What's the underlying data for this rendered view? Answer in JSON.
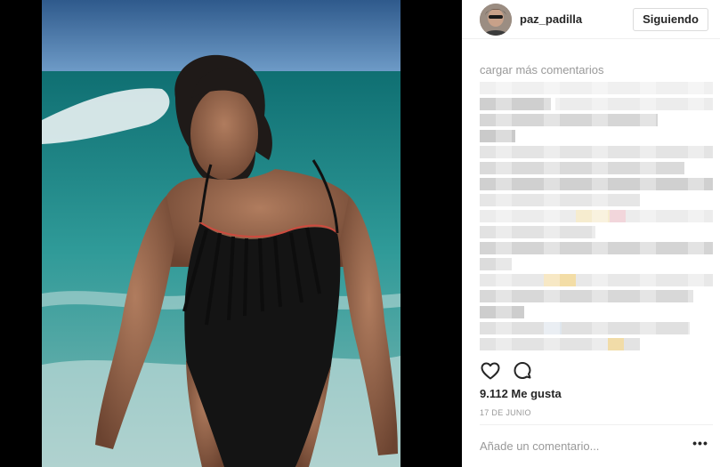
{
  "post": {
    "username": "paz_padilla",
    "follow_label": "Siguiendo",
    "photo_alt": "Mujer con bañador negro en la playa"
  },
  "comments": {
    "load_more": "cargar más comentarios"
  },
  "actions": {
    "likes": "9.112 Me gusta",
    "date": "17 DE JUNIO"
  },
  "composer": {
    "placeholder": "Añade un comentario...",
    "more_label": "•••"
  },
  "icons": {
    "like": "heart-icon",
    "comment": "comment-icon",
    "more": "more-options-icon"
  }
}
